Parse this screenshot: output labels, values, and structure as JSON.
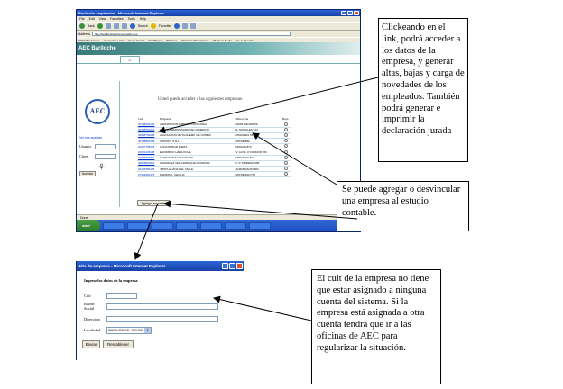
{
  "browser": {
    "title": "Bariloche empleados - Microsoft Internet Explorer",
    "menu": [
      "File",
      "Edit",
      "View",
      "Favorites",
      "Tools",
      "Help"
    ],
    "toolbar": {
      "back": "Back",
      "search": "Search",
      "favorites": "Favorites"
    },
    "address_label": "Address",
    "address": "http://localhost/AEC/empleados.asp",
    "links": [
      "TOSHIBA Access",
      "Customize Links",
      "Free Hotmail",
      "RealPlayer",
      "Windows",
      "Windows Marketplace",
      "Windows Media",
      "Go to Favorites"
    ],
    "status": "Done",
    "status_right": "Local intranet",
    "start_label": "start"
  },
  "app": {
    "header": "AEC Bariloche",
    "logo": "AEC",
    "sidebar_link": "Ver mis cuentas",
    "user_label": "Usuario:",
    "password_label": "Clave:",
    "accept_button": "Aceptar",
    "content_title": "Usted puede acceder a las siguientes empresas:",
    "columns": [
      "Cuit",
      "Empresa",
      "Direccion",
      "Baja"
    ],
    "rows": [
      {
        "cuit": "30708092134",
        "empresa": "AGRUPACION ALBERTO PATAGONIA",
        "direccion": "MAMUSEUMS 59"
      },
      {
        "cuit": "30708751051",
        "empresa": "ALIANZA EMPRESARIA DE COMERCIO",
        "direccion": "E. MORALES 524"
      },
      {
        "cuit": "30668753045",
        "empresa": "ASOCIACION MUTUAL EMP. DE COMER.",
        "direccion": "MORALES 530"
      },
      {
        "cuit": "30708852388",
        "empresa": "CAPIOPY S.R.L.",
        "direccion": "MITRE 880"
      },
      {
        "cuit": "20407768203",
        "empresa": "CONCOMSUD MARIA",
        "direccion": "MUSON 879"
      },
      {
        "cuit": "20201245138",
        "empresa": "ESCRIBIDO HABILOCHE",
        "direccion": "V. ALTE. O'CONNOR 780"
      },
      {
        "cuit": "30635896839",
        "empresa": "FERNANDEZ ALEJANDRO",
        "direccion": "MORALES 524"
      },
      {
        "cuit": "30668852863",
        "empresa": "GONZALEZ VEGA ENRIQUE F.CORNAA",
        "direccion": "F. P. MORENO 586"
      },
      {
        "cuit": "20165589135",
        "empresa": "JUNTA ALIANA DEL VALLE",
        "direccion": "ALBARRACIN 382"
      },
      {
        "cuit": "27334860476",
        "empresa": "MEDRIS A. CECILIA",
        "direccion": "MITRE 660 PTA"
      }
    ],
    "add_button": "Agregar empresa"
  },
  "popup": {
    "title": "Alta de empresa - Microsoft Internet Explorer",
    "heading": "Ingrese los datos de la empresa",
    "cuit_label": "Cuit",
    "razon_label": "Razon Social",
    "direccion_label": "Dirección",
    "localidad_label": "Localidad",
    "localidad_value": "BARILOCHE, S.C.DE",
    "submit_button": "Enviar",
    "reset_button": "Restablecer"
  },
  "callouts": {
    "empresas": "Clickeando en el link, podrá acceder a los datos de la empresa, y generar altas, bajas y carga de novedades de los empleados. También podrá generar e imprimir la declaración jurada",
    "agregar": "Se puede agregar o desvincular una empresa al estudio contable.",
    "cuit": "El cuit de la empresa no tiene que estar asignado a ninguna cuenta del sistema. Si la empresa está asignada a otra cuenta tendrá que ir a las oficinas de AEC para regularizar la situación."
  }
}
